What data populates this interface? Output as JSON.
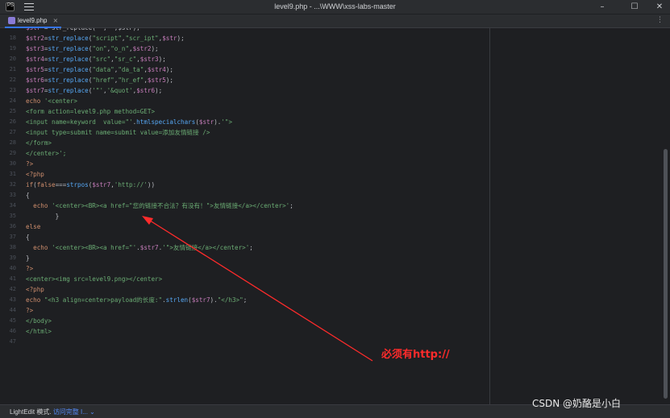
{
  "window": {
    "title": "level9.php - ...\\WWW\\xss-labs-master",
    "minimize_glyph": "–",
    "maximize_glyph": "☐",
    "close_glyph": "✕"
  },
  "tab": {
    "label": "level9.php",
    "close_glyph": "×",
    "more_glyph": "⋮"
  },
  "gutter_lines": [
    "",
    "18",
    "19",
    "20",
    "21",
    "22",
    "23",
    "24",
    "25",
    "26",
    "27",
    "28",
    "29",
    "30",
    "31",
    "32",
    "33",
    "34",
    "35",
    "36",
    "37",
    "38",
    "39",
    "40",
    "41",
    "42",
    "43",
    "44",
    "45",
    "46",
    "47"
  ],
  "code_lines": [
    [
      {
        "t": "$str ",
        "c": "#c77dbb"
      },
      {
        "t": "= str_replace(\"\",\"\",$str);",
        "c": "#bcbec4"
      }
    ],
    [
      {
        "t": "$str2",
        "c": "#c77dbb"
      },
      {
        "t": "=",
        "c": "#bcbec4"
      },
      {
        "t": "str_replace",
        "c": "#56a8f5"
      },
      {
        "t": "(",
        "c": "#bcbec4"
      },
      {
        "t": "\"script\"",
        "c": "#6aab73"
      },
      {
        "t": ",",
        "c": "#bcbec4"
      },
      {
        "t": "\"scr_ipt\"",
        "c": "#6aab73"
      },
      {
        "t": ",",
        "c": "#bcbec4"
      },
      {
        "t": "$str",
        "c": "#c77dbb"
      },
      {
        "t": ");",
        "c": "#bcbec4"
      }
    ],
    [
      {
        "t": "$str3",
        "c": "#c77dbb"
      },
      {
        "t": "=",
        "c": "#bcbec4"
      },
      {
        "t": "str_replace",
        "c": "#56a8f5"
      },
      {
        "t": "(",
        "c": "#bcbec4"
      },
      {
        "t": "\"on\"",
        "c": "#6aab73"
      },
      {
        "t": ",",
        "c": "#bcbec4"
      },
      {
        "t": "\"o_n\"",
        "c": "#6aab73"
      },
      {
        "t": ",",
        "c": "#bcbec4"
      },
      {
        "t": "$str2",
        "c": "#c77dbb"
      },
      {
        "t": ");",
        "c": "#bcbec4"
      }
    ],
    [
      {
        "t": "$str4",
        "c": "#c77dbb"
      },
      {
        "t": "=",
        "c": "#bcbec4"
      },
      {
        "t": "str_replace",
        "c": "#56a8f5"
      },
      {
        "t": "(",
        "c": "#bcbec4"
      },
      {
        "t": "\"src\"",
        "c": "#6aab73"
      },
      {
        "t": ",",
        "c": "#bcbec4"
      },
      {
        "t": "\"sr_c\"",
        "c": "#6aab73"
      },
      {
        "t": ",",
        "c": "#bcbec4"
      },
      {
        "t": "$str3",
        "c": "#c77dbb"
      },
      {
        "t": ");",
        "c": "#bcbec4"
      }
    ],
    [
      {
        "t": "$str5",
        "c": "#c77dbb"
      },
      {
        "t": "=",
        "c": "#bcbec4"
      },
      {
        "t": "str_replace",
        "c": "#56a8f5"
      },
      {
        "t": "(",
        "c": "#bcbec4"
      },
      {
        "t": "\"data\"",
        "c": "#6aab73"
      },
      {
        "t": ",",
        "c": "#bcbec4"
      },
      {
        "t": "\"da_ta\"",
        "c": "#6aab73"
      },
      {
        "t": ",",
        "c": "#bcbec4"
      },
      {
        "t": "$str4",
        "c": "#c77dbb"
      },
      {
        "t": ");",
        "c": "#bcbec4"
      }
    ],
    [
      {
        "t": "$str6",
        "c": "#c77dbb"
      },
      {
        "t": "=",
        "c": "#bcbec4"
      },
      {
        "t": "str_replace",
        "c": "#56a8f5"
      },
      {
        "t": "(",
        "c": "#bcbec4"
      },
      {
        "t": "\"href\"",
        "c": "#6aab73"
      },
      {
        "t": ",",
        "c": "#bcbec4"
      },
      {
        "t": "\"hr_ef\"",
        "c": "#6aab73"
      },
      {
        "t": ",",
        "c": "#bcbec4"
      },
      {
        "t": "$str5",
        "c": "#c77dbb"
      },
      {
        "t": ");",
        "c": "#bcbec4"
      }
    ],
    [
      {
        "t": "$str7",
        "c": "#c77dbb"
      },
      {
        "t": "=",
        "c": "#bcbec4"
      },
      {
        "t": "str_replace",
        "c": "#56a8f5"
      },
      {
        "t": "(",
        "c": "#bcbec4"
      },
      {
        "t": "'\"'",
        "c": "#6aab73"
      },
      {
        "t": ",",
        "c": "#bcbec4"
      },
      {
        "t": "'&quot'",
        "c": "#6aab73"
      },
      {
        "t": ",",
        "c": "#bcbec4"
      },
      {
        "t": "$str6",
        "c": "#c77dbb"
      },
      {
        "t": ");",
        "c": "#bcbec4"
      }
    ],
    [
      {
        "t": "echo ",
        "c": "#cf8e6d"
      },
      {
        "t": "'<center>",
        "c": "#6aab73"
      }
    ],
    [
      {
        "t": "<form action=level9.php method=GET>",
        "c": "#6aab73"
      }
    ],
    [
      {
        "t": "<input name=keyword  value=\"'",
        "c": "#6aab73"
      },
      {
        "t": ".",
        "c": "#bcbec4"
      },
      {
        "t": "htmlspecialchars",
        "c": "#56a8f5"
      },
      {
        "t": "(",
        "c": "#bcbec4"
      },
      {
        "t": "$str",
        "c": "#c77dbb"
      },
      {
        "t": ").",
        "c": "#bcbec4"
      },
      {
        "t": "'\">",
        "c": "#6aab73"
      }
    ],
    [
      {
        "t": "<input type=submit name=submit value=添加友情链接 />",
        "c": "#6aab73"
      }
    ],
    [
      {
        "t": "</form>",
        "c": "#6aab73"
      }
    ],
    [
      {
        "t": "</center>';",
        "c": "#6aab73"
      }
    ],
    [
      {
        "t": "?>",
        "c": "#cf8e6d"
      }
    ],
    [
      {
        "t": "<?php",
        "c": "#cf8e6d"
      }
    ],
    [
      {
        "t": "if",
        "c": "#cf8e6d"
      },
      {
        "t": "(",
        "c": "#bcbec4"
      },
      {
        "t": "false",
        "c": "#cf8e6d"
      },
      {
        "t": "===",
        "c": "#bcbec4"
      },
      {
        "t": "strpos",
        "c": "#56a8f5"
      },
      {
        "t": "(",
        "c": "#bcbec4"
      },
      {
        "t": "$str7",
        "c": "#c77dbb"
      },
      {
        "t": ",",
        "c": "#bcbec4"
      },
      {
        "t": "'http://'",
        "c": "#6aab73"
      },
      {
        "t": "))",
        "c": "#bcbec4"
      }
    ],
    [
      {
        "t": "{",
        "c": "#bcbec4"
      }
    ],
    [
      {
        "t": "  echo ",
        "c": "#cf8e6d"
      },
      {
        "t": "'<center><BR><a href=\"您的链接不合法？有没有！\">友情链接</a></center>'",
        "c": "#6aab73"
      },
      {
        "t": ";",
        "c": "#bcbec4"
      }
    ],
    [
      {
        "t": "        }",
        "c": "#bcbec4"
      }
    ],
    [
      {
        "t": "else",
        "c": "#cf8e6d"
      }
    ],
    [
      {
        "t": "{",
        "c": "#bcbec4"
      }
    ],
    [
      {
        "t": "  echo ",
        "c": "#cf8e6d"
      },
      {
        "t": "'<center><BR><a href=\"'",
        "c": "#6aab73"
      },
      {
        "t": ".",
        "c": "#bcbec4"
      },
      {
        "t": "$str7",
        "c": "#c77dbb"
      },
      {
        "t": ".",
        "c": "#bcbec4"
      },
      {
        "t": "'\">友情链接</a></center>'",
        "c": "#6aab73"
      },
      {
        "t": ";",
        "c": "#bcbec4"
      }
    ],
    [
      {
        "t": "}",
        "c": "#bcbec4"
      }
    ],
    [
      {
        "t": "?>",
        "c": "#cf8e6d"
      }
    ],
    [
      {
        "t": "<center><img src=level9.png></center>",
        "c": "#6aab73"
      }
    ],
    [
      {
        "t": "<?php",
        "c": "#cf8e6d"
      }
    ],
    [
      {
        "t": "echo ",
        "c": "#cf8e6d"
      },
      {
        "t": "\"<h3 align=center>payload的长度:\"",
        "c": "#6aab73"
      },
      {
        "t": ".",
        "c": "#bcbec4"
      },
      {
        "t": "strlen",
        "c": "#56a8f5"
      },
      {
        "t": "(",
        "c": "#bcbec4"
      },
      {
        "t": "$str7",
        "c": "#c77dbb"
      },
      {
        "t": ").",
        "c": "#bcbec4"
      },
      {
        "t": "\"</h3>\"",
        "c": "#6aab73"
      },
      {
        "t": ";",
        "c": "#bcbec4"
      }
    ],
    [
      {
        "t": "?>",
        "c": "#cf8e6d"
      }
    ],
    [
      {
        "t": "</body>",
        "c": "#6aab73"
      }
    ],
    [
      {
        "t": "</html>",
        "c": "#6aab73"
      }
    ],
    []
  ],
  "annotation": {
    "text": "必须有http://",
    "color": "#ff2b2b"
  },
  "status": {
    "mode": "LightEdit 模式.",
    "link": "访问完整 I...",
    "chevron": "⌄"
  },
  "watermark": "CSDN @奶酪是小白"
}
